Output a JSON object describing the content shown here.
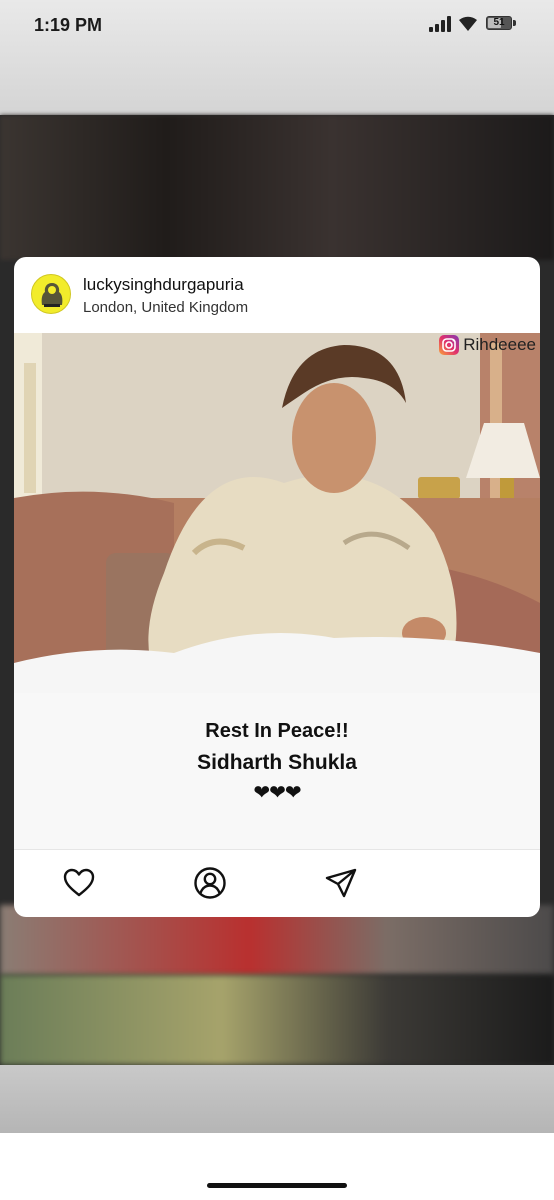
{
  "status_bar": {
    "time": "1:19 PM",
    "battery_level": "51",
    "icons": [
      "signal-icon",
      "wifi-icon",
      "battery-icon"
    ]
  },
  "post": {
    "username": "luckysinghdurgapuria",
    "location": "London, United Kingdom",
    "watermark": "Rihdeeee",
    "caption_line1": "Rest In Peace!!",
    "caption_line2": "Sidharth Shukla",
    "hearts": "❤❤❤",
    "actions": [
      "heart-icon",
      "profile-icon",
      "send-icon"
    ]
  },
  "colors": {
    "avatar_bg": "#f2ec2b",
    "card_bg": "#ffffff",
    "text": "#111111"
  }
}
